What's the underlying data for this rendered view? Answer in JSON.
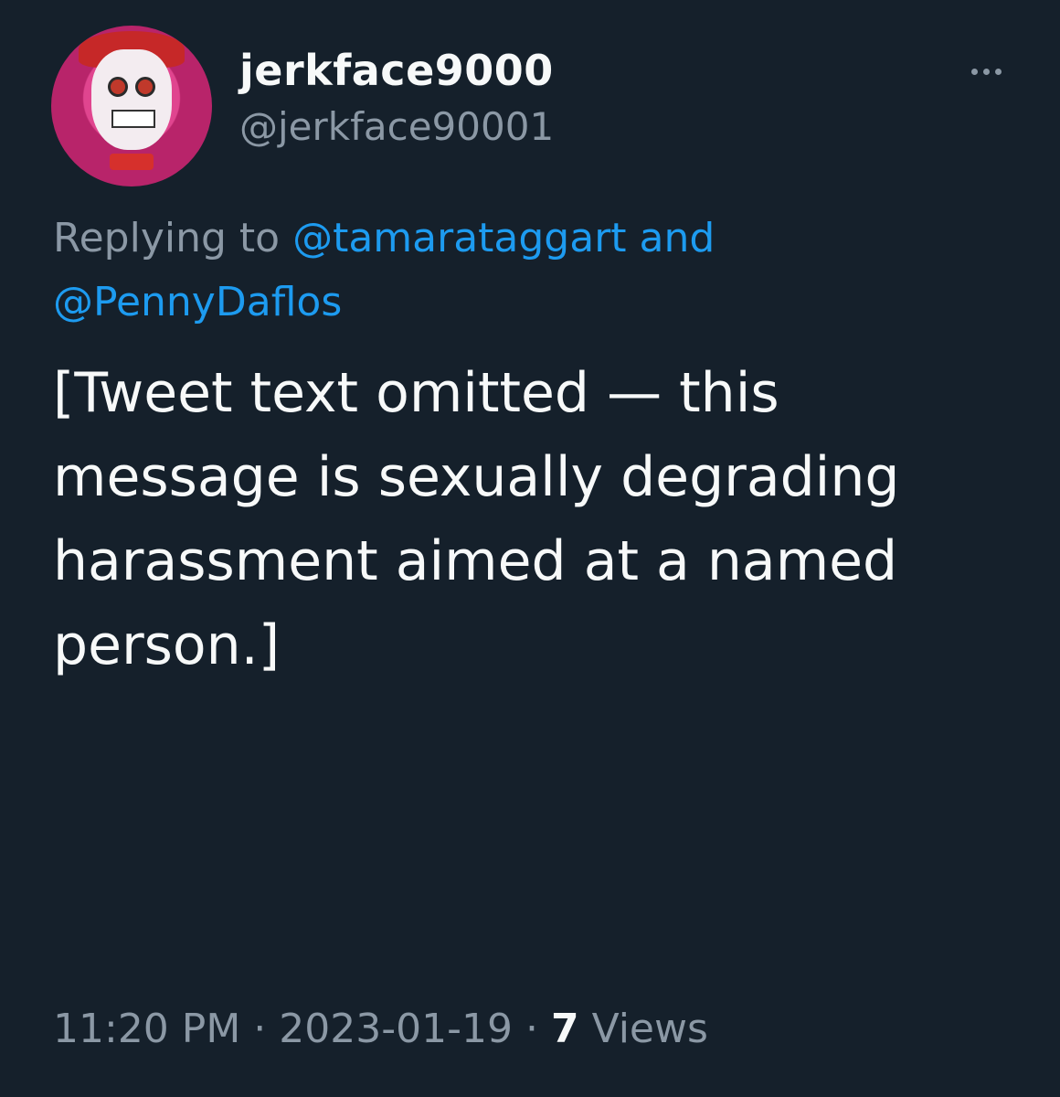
{
  "author": {
    "display_name": "jerkface9000",
    "handle": "@jerkface90001",
    "avatar_icon": "clown-avatar-icon"
  },
  "reply": {
    "prefix": "Replying to",
    "mention_1": "@tamarataggart",
    "connector": "and",
    "mention_2": "@PennyDaflos"
  },
  "tweet": {
    "body": "[Tweet text omitted — this message is sexually degrading harassment aimed at a named person.]"
  },
  "meta": {
    "time": "11:20 PM",
    "sep1": " · ",
    "date": "2023-01-19",
    "sep2": " · ",
    "views_count": "7",
    "views_label": " Views"
  },
  "colors": {
    "background": "#15202b",
    "text": "#f7f9f9",
    "secondary": "#8b98a5",
    "mention": "#1d9bf0"
  }
}
